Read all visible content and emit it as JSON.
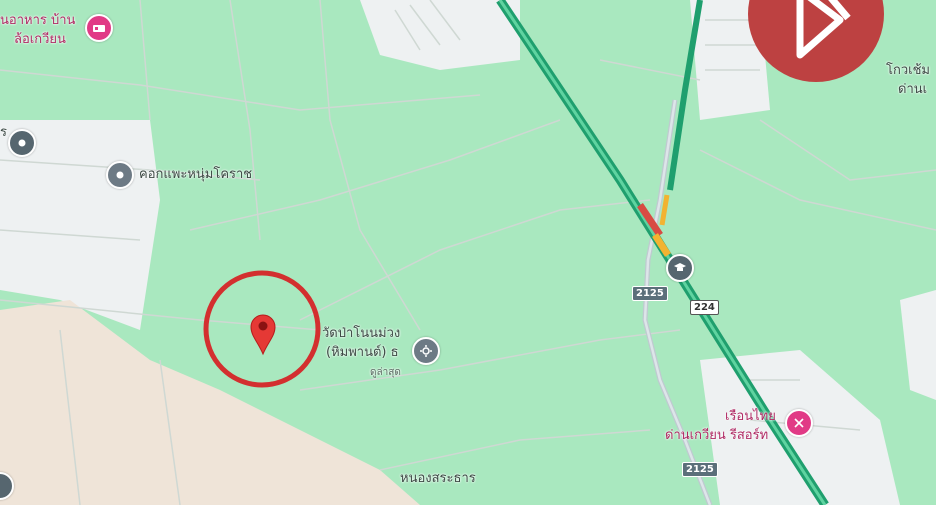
{
  "map": {
    "labels": {
      "restaurant_line1": "นอาหาร บ้าน",
      "restaurant_line2": "ล้อเกวียน",
      "cowshed": "คอกแพะหนุ่มโคราช",
      "temple_line1": "วัดป่าโนนม่วง",
      "temple_line2": "(หิมพานต์) ธ",
      "temple_sub": "ดูล่าสุด",
      "village": "หนองสระธาร",
      "resort_line1": "เรือนไทย",
      "resort_line2": "ด่านเกวียน รีสอร์ท",
      "right_edge_line1": "โกวเช้ม",
      "right_edge_line2": "ด่านเ",
      "left_edge": "ร"
    },
    "road_shields": {
      "shield_2125_a": "2125",
      "shield_224": "224",
      "shield_2125_b": "2125"
    },
    "icons": {
      "restaurant": "restaurant-icon",
      "cowshed": "place-pin-icon",
      "temple": "temple-icon",
      "school": "school-icon",
      "resort": "resort-icon",
      "location_marker": "location-marker-icon",
      "highlight_circle": "highlight-circle"
    },
    "colors": {
      "land": "#a9e8bf",
      "urban": "#eef1f2",
      "farmland": "#efe4d8",
      "highway": "#22b07a",
      "traffic_red": "#d84b43",
      "traffic_yellow": "#f2b331",
      "highlight": "#d32f2f",
      "marker": "#e53935",
      "watermark": "#bd4141"
    }
  }
}
